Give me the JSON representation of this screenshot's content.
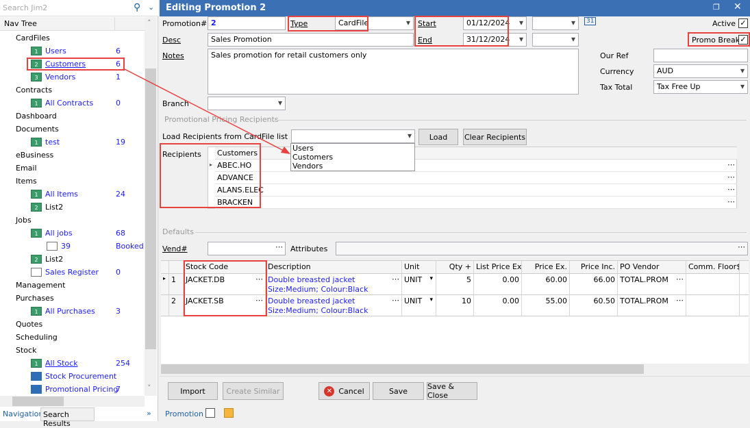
{
  "nav": {
    "search_placeholder": "Search Jim2",
    "header": "Nav Tree",
    "items": [
      {
        "label": "CardFiles",
        "level": 0
      },
      {
        "label": "Users",
        "level": 1,
        "count": "6",
        "icon": "1"
      },
      {
        "label": "Customers",
        "level": 1,
        "count": "6",
        "icon": "2"
      },
      {
        "label": "Vendors",
        "level": 1,
        "count": "1",
        "icon": "3"
      },
      {
        "label": "Contracts",
        "level": 0
      },
      {
        "label": "All Contracts",
        "level": 1,
        "count": "0",
        "icon": "1"
      },
      {
        "label": "Dashboard",
        "level": 0
      },
      {
        "label": "Documents",
        "level": 0
      },
      {
        "label": "test",
        "level": 1,
        "count": "19",
        "icon": "1"
      },
      {
        "label": "eBusiness",
        "level": 0
      },
      {
        "label": "Email",
        "level": 0
      },
      {
        "label": "Items",
        "level": 0
      },
      {
        "label": "All Items",
        "level": 1,
        "count": "24",
        "icon": "1"
      },
      {
        "label": "List2",
        "level": 1,
        "icon": "2",
        "plain": true
      },
      {
        "label": "Jobs",
        "level": 0
      },
      {
        "label": "All jobs",
        "level": 1,
        "count": "68",
        "icon": "1"
      },
      {
        "label": "39",
        "level": 2,
        "count": "Booked",
        "icon": "doc"
      },
      {
        "label": "List2",
        "level": 1,
        "icon": "2",
        "plain": true
      },
      {
        "label": "Sales Register",
        "level": 1,
        "count": "0",
        "icon": "reg"
      },
      {
        "label": "Management",
        "level": 0
      },
      {
        "label": "Purchases",
        "level": 0
      },
      {
        "label": "All Purchases",
        "level": 1,
        "count": "3",
        "icon": "1"
      },
      {
        "label": "Quotes",
        "level": 0
      },
      {
        "label": "Scheduling",
        "level": 0
      },
      {
        "label": "Stock",
        "level": 0
      },
      {
        "label": "All Stock",
        "level": 1,
        "count": "254",
        "icon": "1",
        "underline": true
      },
      {
        "label": "Stock Procurement",
        "level": 1,
        "icon": "truck"
      },
      {
        "label": "Promotional Pricing",
        "level": 1,
        "count": "7",
        "icon": "gift"
      }
    ],
    "tabs": [
      "Navigation",
      "Search Results"
    ]
  },
  "window": {
    "title": "Editing Promotion 2"
  },
  "form": {
    "promotion_label": "Promotion#",
    "promotion_value": "2",
    "type_label": "Type",
    "type_value": "CardFile",
    "start_label": "Start",
    "start_value": "01/12/2024",
    "end_label": "End",
    "end_value": "31/12/2024",
    "active_label": "Active",
    "active": true,
    "promo_break_label": "Promo Break",
    "promo_break": true,
    "desc_label": "Desc",
    "desc_value": "Sales Promotion",
    "notes_label": "Notes",
    "notes_value": "Sales promotion for retail customers only",
    "our_ref_label": "Our Ref",
    "our_ref_value": "",
    "currency_label": "Currency",
    "currency_value": "AUD",
    "tax_label": "Tax Total",
    "tax_value": "Tax Free Up",
    "branch_label": "Branch",
    "branch_value": ""
  },
  "recipients": {
    "section": "Promotional Pricing Recipients",
    "load_label": "Load Recipients from CardFile list",
    "load_value": "",
    "load_button": "Load",
    "clear_button": "Clear Recipients",
    "dropdown_options": [
      "Users",
      "Customers",
      "Vendors"
    ],
    "label": "Recipients",
    "column": "Customers",
    "rows": [
      "ABEC.HO",
      "ADVANCE",
      "ALANS.ELEC",
      "BRACKEN"
    ]
  },
  "defaults": {
    "section": "Defaults",
    "vend_label": "Vend#",
    "vend_value": "",
    "attributes_label": "Attributes",
    "attributes_value": ""
  },
  "items": {
    "columns": [
      "Stock Code",
      "Description",
      "Unit",
      "Qty +",
      "List Price Ex.",
      "Price Ex.",
      "Price Inc.",
      "PO Vendor",
      "Comm. Floor$"
    ],
    "rows": [
      {
        "n": "1",
        "code": "JACKET.DB",
        "desc": "Double breasted jacket",
        "desc2": "Size:Medium; Colour:Black",
        "unit": "UNIT",
        "qty": "5",
        "list": "0.00",
        "ex": "60.00",
        "inc": "66.00",
        "vendor": "TOTAL.PROM",
        "floor": ""
      },
      {
        "n": "2",
        "code": "JACKET.SB",
        "desc": "Double breasted jacket",
        "desc2": "Size:Medium; Colour:Black",
        "unit": "UNIT",
        "qty": "10",
        "list": "0.00",
        "ex": "55.00",
        "inc": "60.50",
        "vendor": "TOTAL.PROM",
        "floor": ""
      }
    ]
  },
  "buttons": {
    "import": "Import",
    "create_similar": "Create Similar",
    "cancel": "Cancel",
    "save": "Save",
    "save_close": "Save & Close"
  },
  "bottom_tabs": {
    "promotion": "Promotion"
  },
  "colors": {
    "title_bar": "#3c70b5",
    "link": "#1a1aff",
    "annotation": "#e8413e"
  }
}
